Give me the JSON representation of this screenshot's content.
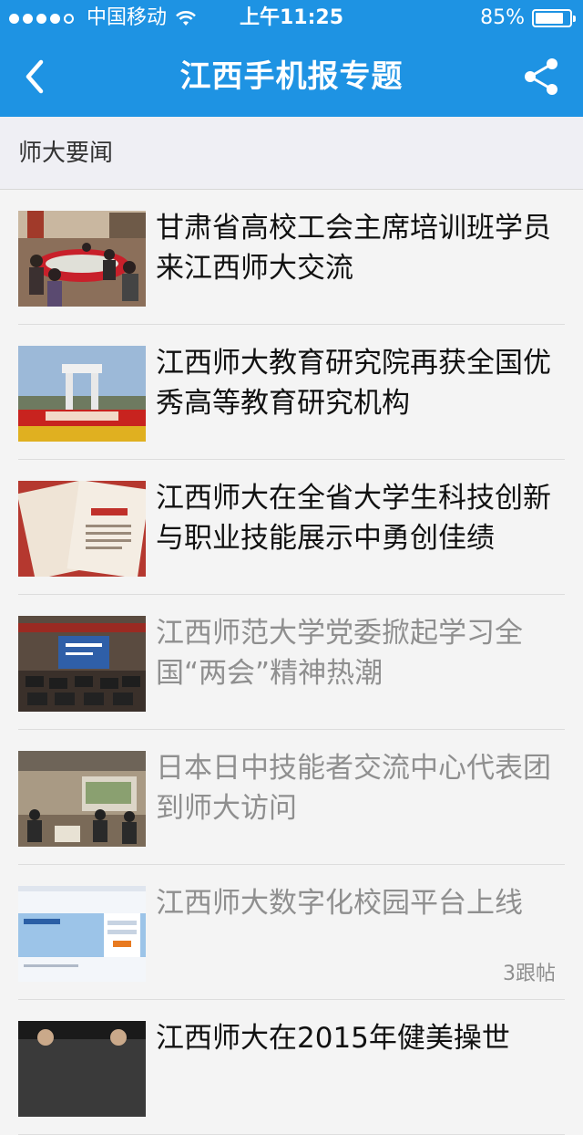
{
  "status_bar": {
    "carrier": "中国移动",
    "time": "上午11:25",
    "battery_percent": "85%",
    "battery_level": 0.85
  },
  "navbar": {
    "back_icon": "chevron-left-icon",
    "title": "江西手机报专题",
    "share_icon": "share-icon"
  },
  "section": {
    "title": "师大要闻"
  },
  "articles": [
    {
      "title": "甘肃省高校工会主席培训班学员来江西师大交流",
      "read": false,
      "meta": ""
    },
    {
      "title": "江西师大教育研究院再获全国优秀高等教育研究机构",
      "read": false,
      "meta": ""
    },
    {
      "title": "江西师大在全省大学生科技创新与职业技能展示中勇创佳绩",
      "read": false,
      "meta": ""
    },
    {
      "title": "江西师范大学党委掀起学习全国“两会”精神热潮",
      "read": true,
      "meta": ""
    },
    {
      "title": "日本日中技能者交流中心代表团到师大访问",
      "read": true,
      "meta": ""
    },
    {
      "title": "江西师大数字化校园平台上线",
      "read": true,
      "meta": "3跟帖"
    },
    {
      "title": "江西师大在2015年健美操世",
      "read": false,
      "meta": ""
    }
  ]
}
